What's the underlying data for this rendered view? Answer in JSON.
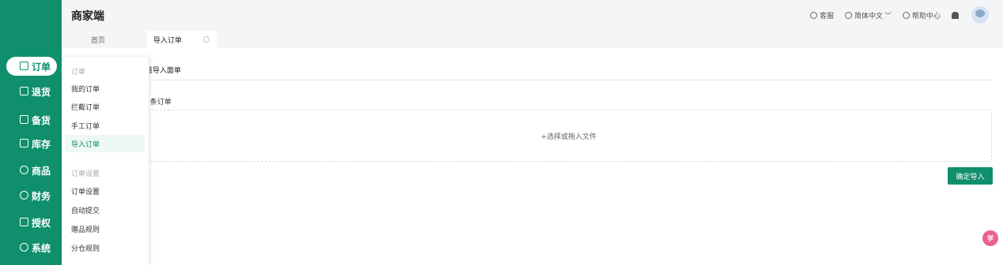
{
  "app": {
    "brand": "商家端"
  },
  "header": {
    "service_label": "客服",
    "language_label": "简体中文",
    "help_label": "帮助中心"
  },
  "tabs": [
    {
      "label": "首页"
    },
    {
      "label": "导入订单"
    }
  ],
  "sidebar": {
    "items": [
      {
        "label": "订单",
        "active": true
      },
      {
        "label": "退货"
      },
      {
        "label": "备货"
      },
      {
        "label": "库存"
      },
      {
        "label": "商品"
      },
      {
        "label": "财务"
      },
      {
        "label": "授权"
      },
      {
        "label": "系统"
      }
    ]
  },
  "flyout": {
    "group1_title": "订单",
    "group1_items": [
      "我的订单",
      "拦截订单",
      "手工订单",
      "导入订单"
    ],
    "group2_title": "订单设置",
    "group2_items": [
      "订单设置",
      "自动提交",
      "赠品规则",
      "分仓规则"
    ]
  },
  "main": {
    "heading_fragment": "量导入面单",
    "count_fragment": "0条订单",
    "upload_text": "+选择或拖入文件",
    "confirm_label": "确定导入"
  },
  "colors": {
    "brand": "#0f8f6c",
    "badge": "#e9648d"
  },
  "float_badge_text": "学"
}
